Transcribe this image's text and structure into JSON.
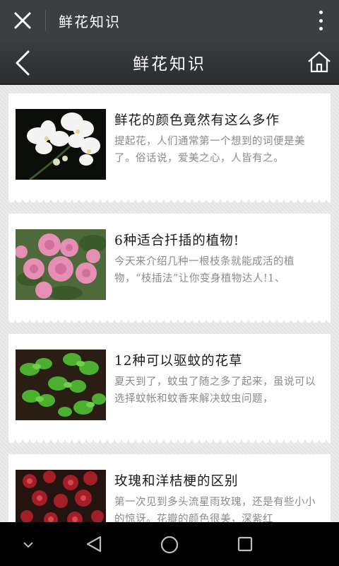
{
  "topbar": {
    "title": "鲜花知识"
  },
  "header": {
    "title": "鲜花知识"
  },
  "articles": [
    {
      "title": "鲜花的颜色竟然有这么多作",
      "desc": "提起花，人们通常第一个想到的词便是美了。俗话说，爱美之心，人皆有之。"
    },
    {
      "title": "6种适合扦插的植物!",
      "desc": "今天来介绍几种一根枝条就能成活的植物，“枝插法”让你变身植物达人!1、"
    },
    {
      "title": "12种可以驱蚊的花草",
      "desc": "夏天到了，蚊虫了随之多了起来，虽说可以选择蚊帐和蚊香来解决蚊虫问题，"
    },
    {
      "title": "玫瑰和洋桔梗的区别",
      "desc": "第一次见到多头流星雨玫瑰，还是有些小小的惊讶。花瓣的颜色很美，深紫红"
    }
  ],
  "icons": {
    "close": "close-icon",
    "more": "more-vertical-icon",
    "back": "chevron-left-icon",
    "home": "home-icon"
  }
}
